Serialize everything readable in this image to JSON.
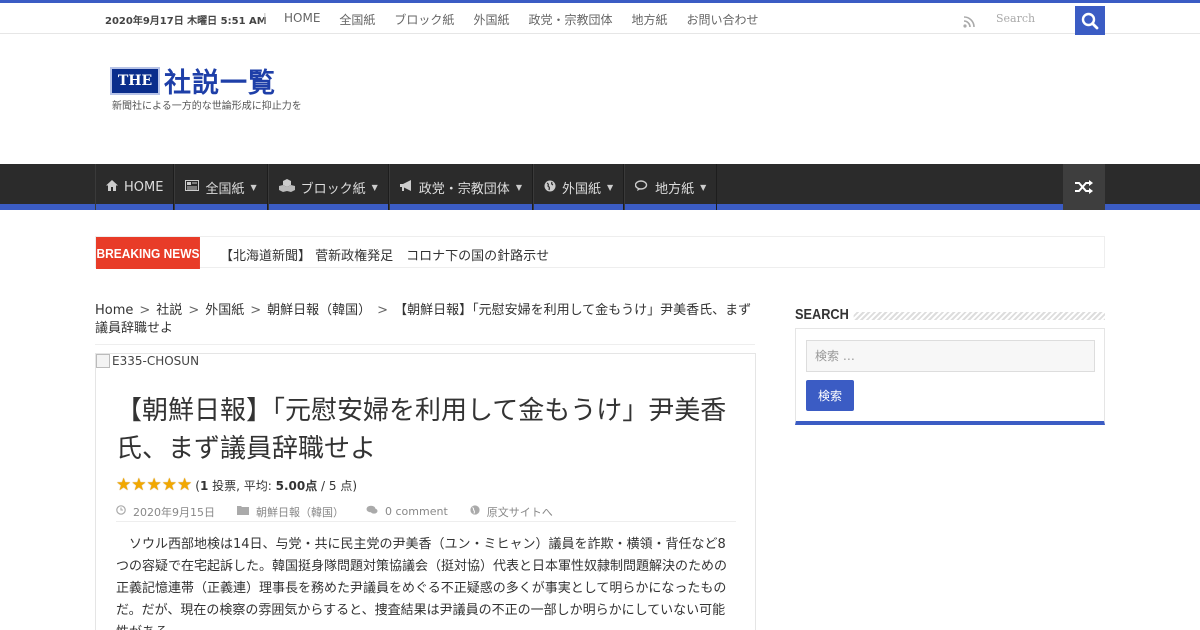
{
  "topbar": {
    "date": "2020年9月17日 木曜日 5:51 AM",
    "nav": [
      "HOME",
      "全国紙",
      "ブロック紙",
      "外国紙",
      "政党・宗教団体",
      "地方紙",
      "お問い合わせ"
    ],
    "search_placeholder": "Search"
  },
  "logo": {
    "badge": "THE",
    "title": "社説一覧",
    "tagline": "新聞社による一方的な世論形成に抑止力を"
  },
  "mainnav": {
    "items": [
      {
        "label": "HOME",
        "icon": "home-icon",
        "dropdown": false
      },
      {
        "label": "全国紙",
        "icon": "newspaper-icon",
        "dropdown": true
      },
      {
        "label": "ブロック紙",
        "icon": "cubes-icon",
        "dropdown": true
      },
      {
        "label": "政党・宗教団体",
        "icon": "bullhorn-icon",
        "dropdown": true
      },
      {
        "label": "外国紙",
        "icon": "globe-icon",
        "dropdown": true
      },
      {
        "label": "地方紙",
        "icon": "comments-icon",
        "dropdown": true
      }
    ]
  },
  "breaking": {
    "label": "Breaking News",
    "text": "【北海道新聞】 菅新政権発足　コロナ下の国の針路示せ"
  },
  "breadcrumb": {
    "items": [
      "Home",
      "社説",
      "外国紙",
      "朝鮮日報（韓国）"
    ],
    "current": "【朝鮮日報】「元慰安婦を利用して金もうけ」尹美香氏、まず議員辞職せよ"
  },
  "post": {
    "image_alt": "E335-CHOSUN",
    "title": "【朝鮮日報】「元慰安婦を利用して金もうけ」尹美香氏、まず議員辞職せよ",
    "rating": {
      "stars": 5,
      "votes": "1",
      "avg": "5.00",
      "text_a": " 投票, 平均: ",
      "text_b": " 点 / 5 点)"
    },
    "meta": {
      "date": "2020年9月15日",
      "category": "朝鮮日報（韓国）",
      "comments": "0 comment",
      "source": "原文サイトへ"
    },
    "body": "ソウル西部地検は14日、与党・共に民主党の尹美香（ユン・ミヒャン）議員を詐欺・横領・背任など8つの容疑で在宅起訴した。韓国挺身隊問題対策協議会（挺対協）代表と日本軍性奴隷制問題解決のための正義記憶連帯（正義連）理事長を務めた尹議員をめぐる不正疑惑の多くが事実として明らかになったものだ。だが、現在の検察の雰囲気からすると、捜査結果は尹議員の不正の一部しか明らかにしていない可能性がある。"
  },
  "sidebar": {
    "title": "Search",
    "placeholder": "検索 …",
    "button": "検索"
  },
  "colors": {
    "accent": "#3b5cc4",
    "nav_bg": "#2b2b2b",
    "breaking": "#e83c28"
  }
}
